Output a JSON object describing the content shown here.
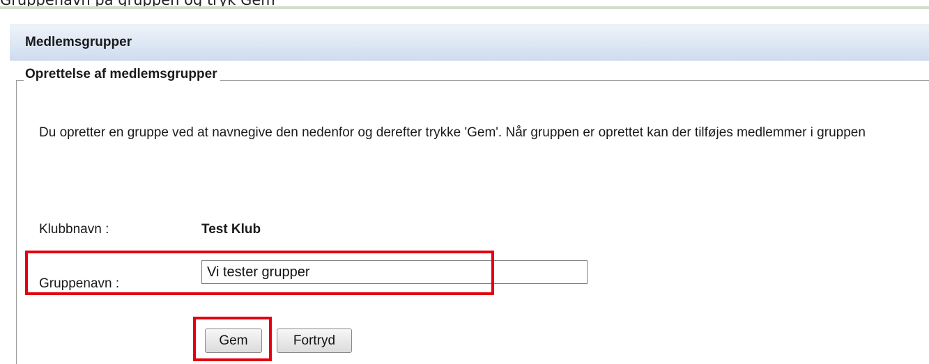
{
  "top_caption": "Gruppenavn på gruppen og tryk Gem",
  "panel": {
    "title": "Medlemsgrupper"
  },
  "form": {
    "legend": "Oprettelse af medlemsgrupper",
    "description": "Du opretter en gruppe ved at navnegive den nedenfor og derefter trykke 'Gem'. Når gruppen er oprettet kan der tilføjes medlemmer i gruppen",
    "club_label": "Klubbnavn :",
    "club_value": "Test Klub",
    "group_label": "Gruppenavn :",
    "group_value": "Vi tester grupper"
  },
  "buttons": {
    "save": "Gem",
    "cancel": "Fortryd"
  },
  "colors": {
    "highlight": "#e3000f",
    "header_bg": "#dde7f4"
  }
}
